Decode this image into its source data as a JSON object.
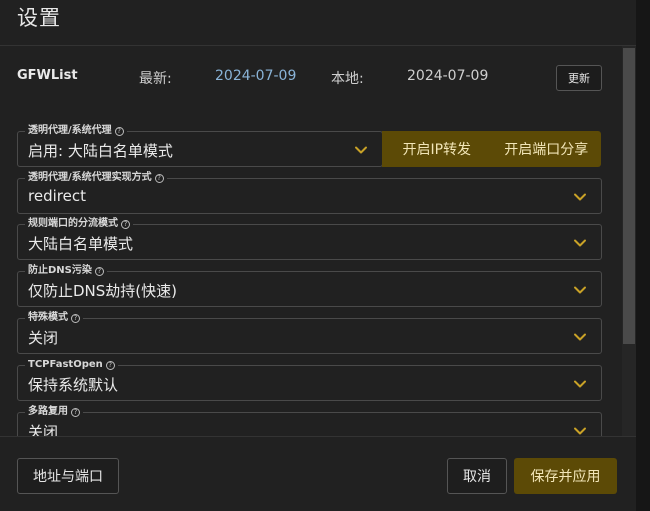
{
  "dialog": {
    "title": "设置"
  },
  "gfwlist": {
    "name": "GFWList",
    "latest_label": "最新:",
    "latest_value": "2024-07-09",
    "local_label": "本地:",
    "local_value": "2024-07-09",
    "update_label": "更新"
  },
  "fields": [
    {
      "label": "透明代理/系统代理",
      "value": "启用: 大陆白名单模式"
    },
    {
      "label": "透明代理/系统代理实现方式",
      "value": "redirect"
    },
    {
      "label": "规则端口的分流模式",
      "value": "大陆白名单模式"
    },
    {
      "label": "防止DNS污染",
      "value": "仅防止DNS劫持(快速)"
    },
    {
      "label": "特殊模式",
      "value": "关闭"
    },
    {
      "label": "TCPFastOpen",
      "value": "保持系统默认"
    },
    {
      "label": "多路复用",
      "value": "关闭"
    }
  ],
  "proxy_actions": {
    "ip_forward_label": "开启IP转发",
    "port_share_label": "开启端口分享"
  },
  "footer": {
    "address_port_label": "地址与端口",
    "cancel_label": "取消",
    "save_apply_label": "保存并应用"
  },
  "colors": {
    "accent": "#5c4a06",
    "link": "#8ab4d8",
    "background": "#212121"
  },
  "icons": {
    "help": "question-circle-icon",
    "dropdown": "chevron-down-icon"
  }
}
